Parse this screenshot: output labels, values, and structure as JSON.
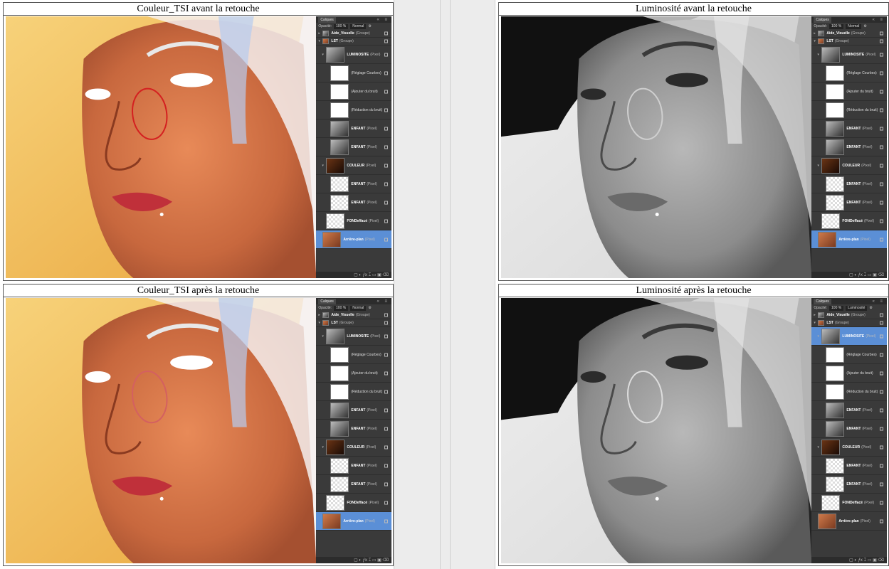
{
  "cells": [
    {
      "title": "Couleur_TSI avant la retouche",
      "mode": "color",
      "circle_color": "#d42020"
    },
    {
      "title": "Luminosité avant la retouche",
      "mode": "gray",
      "circle_color": "#cfcfcf"
    },
    {
      "title": "Couleur_TSI après la retouche",
      "mode": "color",
      "circle_color": "#d46060"
    },
    {
      "title": "Luminosité après la retouche",
      "mode": "gray",
      "circle_color": "#dddddd"
    }
  ],
  "panel": {
    "tab": "Calques",
    "opacity_label": "Opacité:",
    "opacity_value": "100 %",
    "blend_mode": "Normal",
    "blend_mode_lum_after": "Luminosité",
    "head_icons": "« ≡",
    "foot_icons": "▢ ◐ ƒx ⌶ ▭ ▣ ⌫",
    "layers": [
      {
        "name": "Aide_Visuelle",
        "type": "(Groupe)",
        "kind": "short",
        "thumb": "gray",
        "indent": 0,
        "twisty": "▸"
      },
      {
        "name": "LST",
        "type": "(Groupe)",
        "kind": "short",
        "thumb": "skin",
        "indent": 0,
        "twisty": "▾"
      },
      {
        "name": "LUMINOSITE",
        "type": "(Pixel)",
        "kind": "tall",
        "thumb": "gray",
        "indent": 1,
        "twisty": "▾"
      },
      {
        "name": "(Réglage Courbes)",
        "type": "",
        "kind": "tall",
        "thumb": "white",
        "indent": 2,
        "twisty": "",
        "light": true
      },
      {
        "name": "(Ajouter du bruit)",
        "type": "",
        "kind": "tall",
        "thumb": "white",
        "indent": 2,
        "twisty": "",
        "light": true
      },
      {
        "name": "(Réduction du bruit)",
        "type": "",
        "kind": "tall",
        "thumb": "white",
        "indent": 2,
        "twisty": "",
        "light": true
      },
      {
        "name": "ENFANT",
        "type": "(Pixel)",
        "kind": "tall",
        "thumb": "gray",
        "indent": 2,
        "twisty": ""
      },
      {
        "name": "ENFANT",
        "type": "(Pixel)",
        "kind": "tall",
        "thumb": "gray",
        "indent": 2,
        "twisty": ""
      },
      {
        "name": "COULEUR",
        "type": "(Pixel)",
        "kind": "tall",
        "thumb": "dark",
        "indent": 1,
        "twisty": "▾"
      },
      {
        "name": "ENFANT",
        "type": "(Pixel)",
        "kind": "tall",
        "thumb": "check",
        "indent": 2,
        "twisty": ""
      },
      {
        "name": "ENFANT",
        "type": "(Pixel)",
        "kind": "tall",
        "thumb": "check",
        "indent": 2,
        "twisty": ""
      },
      {
        "name": "FONDeffacé",
        "type": "(Pixel)",
        "kind": "tall",
        "thumb": "check",
        "indent": 1,
        "twisty": ""
      },
      {
        "name": "Arrière-plan",
        "type": "(Pixel)",
        "kind": "tall",
        "thumb": "skin",
        "indent": 0,
        "twisty": "",
        "selected": true
      }
    ]
  }
}
